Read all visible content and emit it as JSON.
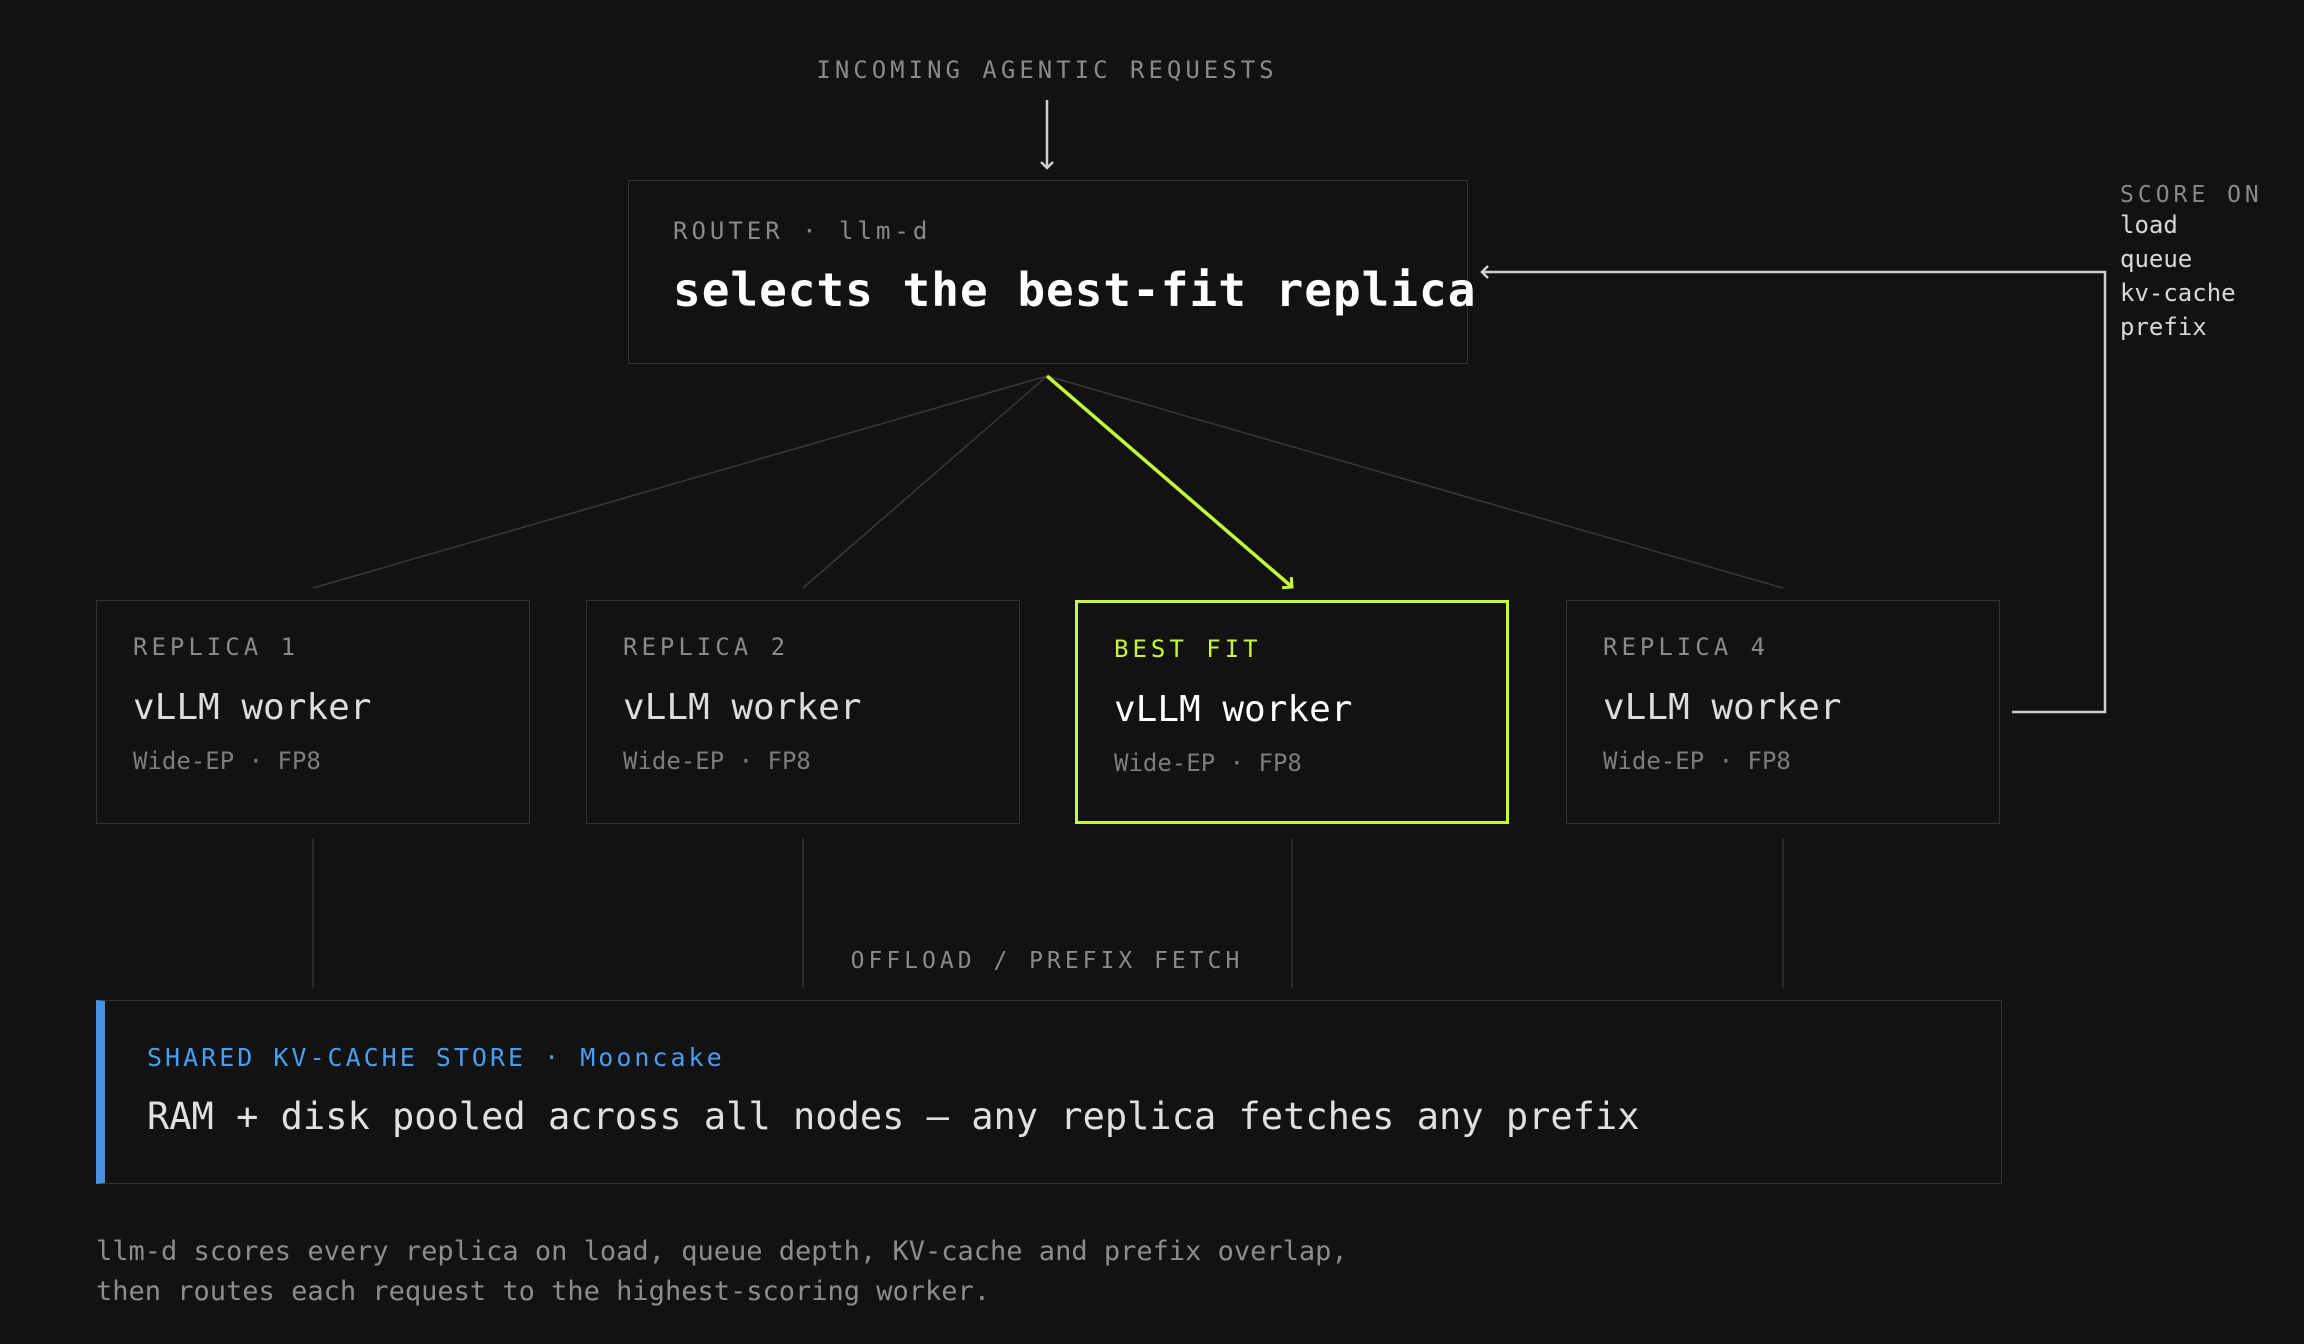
{
  "header": {
    "incoming": "INCOMING AGENTIC REQUESTS"
  },
  "router": {
    "label": "ROUTER · llm-d",
    "title": "selects the best-fit replica"
  },
  "replicas": [
    {
      "label": "REPLICA 1",
      "title": "vLLM worker",
      "subtitle": "Wide-EP · FP8"
    },
    {
      "label": "REPLICA 2",
      "title": "vLLM worker",
      "subtitle": "Wide-EP · FP8"
    },
    {
      "label": "BEST FIT",
      "title": "vLLM worker",
      "subtitle": "Wide-EP · FP8"
    },
    {
      "label": "REPLICA 4",
      "title": "vLLM worker",
      "subtitle": "Wide-EP · FP8"
    }
  ],
  "score": {
    "heading": "SCORE ON",
    "items": [
      "load",
      "queue",
      "kv-cache",
      "prefix"
    ]
  },
  "offload": {
    "label": "OFFLOAD / PREFIX FETCH"
  },
  "kv_store": {
    "label": "SHARED KV-CACHE STORE · Mooncake",
    "title": "RAM + disk pooled across all nodes — any replica fetches any prefix"
  },
  "caption": {
    "line1": "llm-d scores every replica on load, queue depth, KV-cache and prefix overlap,",
    "line2": "then routes each request to the highest-scoring worker."
  },
  "colors": {
    "background": "#121212",
    "accent_best_fit": "#c6f73a",
    "accent_kv": "#4a90e2",
    "border": "#333333"
  }
}
